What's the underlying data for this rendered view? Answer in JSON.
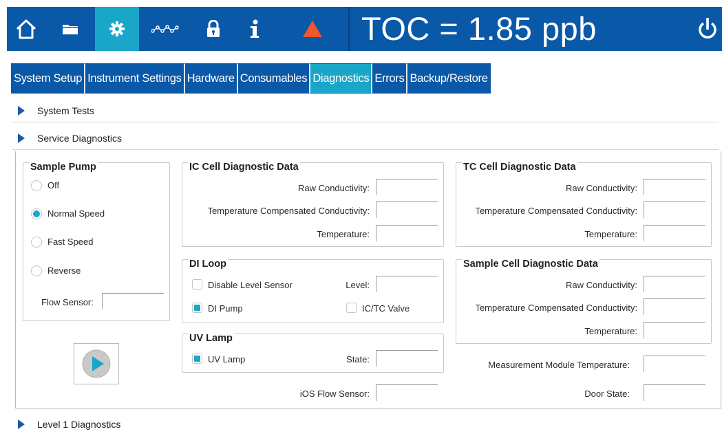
{
  "header": {
    "icons": [
      "home-icon",
      "folder-icon",
      "gear-icon",
      "waveform-icon",
      "lock-icon",
      "info-icon",
      "warning-icon"
    ],
    "toc_text": "TOC = 1.85 ppb",
    "colors": {
      "bar": "#0a58a8",
      "active": "#19a6c9",
      "warning": "#f0582b"
    }
  },
  "tabs": [
    {
      "label": "System Setup"
    },
    {
      "label": "Instrument Settings"
    },
    {
      "label": "Hardware"
    },
    {
      "label": "Consumables"
    },
    {
      "label": "Diagnostics"
    },
    {
      "label": "Errors"
    },
    {
      "label": "Backup/Restore"
    }
  ],
  "sections": {
    "system_tests": "System Tests",
    "service_diagnostics": "Service Diagnostics",
    "level1": "Level 1 Diagnostics"
  },
  "sample_pump": {
    "title": "Sample Pump",
    "options": [
      "Off",
      "Normal Speed",
      "Fast Speed",
      "Reverse"
    ],
    "selected": "Normal Speed",
    "flow_sensor_label": "Flow Sensor:",
    "flow_sensor_value": ""
  },
  "ic_cell": {
    "title": "IC Cell Diagnostic Data",
    "raw": "Raw Conductivity:",
    "temp_comp": "Temperature Compensated Conductivity:",
    "temperature": "Temperature:"
  },
  "tc_cell": {
    "title": "TC Cell Diagnostic Data",
    "raw": "Raw Conductivity:",
    "temp_comp": "Temperature Compensated Conductivity:",
    "temperature": "Temperature:"
  },
  "di_loop": {
    "title": "DI Loop",
    "disable_level_sensor": "Disable Level Sensor",
    "level": "Level:",
    "di_pump": "DI Pump",
    "ictc_valve": "IC/TC Valve"
  },
  "sample_cell": {
    "title": "Sample Cell Diagnostic Data",
    "raw": "Raw Conductivity:",
    "temp_comp": "Temperature Compensated Conductivity:",
    "temperature": "Temperature:"
  },
  "uv_lamp": {
    "title": "UV Lamp",
    "uv_lamp": "UV Lamp",
    "state": "State:"
  },
  "misc": {
    "ios_flow_sensor": "iOS Flow Sensor:",
    "measurement_module_temperature": "Measurement Module Temperature:",
    "door_state": "Door State:"
  }
}
